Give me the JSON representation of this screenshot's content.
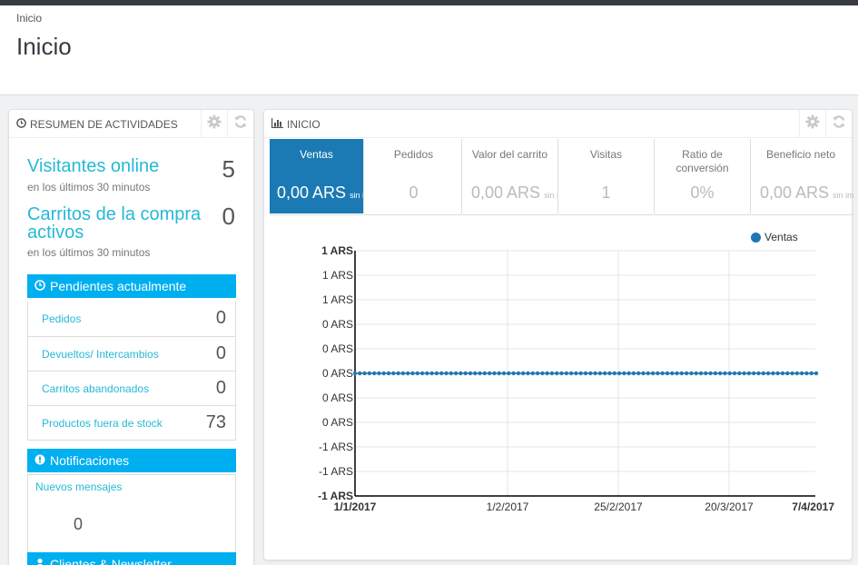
{
  "breadcrumb": "Inicio",
  "page_title": "Inicio",
  "activity": {
    "title": "Resumen de actividades",
    "visitors_label": "Visitantes online",
    "visitors_sub": "en los últimos 30 minutos",
    "visitors_value": "5",
    "carts_label": "Carritos de la compra activos",
    "carts_sub": "en los últimos 30 minutos",
    "carts_value": "0",
    "pending_title": "Pendientes actualmente",
    "pending": [
      {
        "label": "Pedidos",
        "count": "0"
      },
      {
        "label": "Devueltos/ Intercambios",
        "count": "0"
      },
      {
        "label": "Carritos abandonados",
        "count": "0"
      },
      {
        "label": "Productos fuera de stock",
        "count": "73"
      }
    ],
    "notif_title": "Notificaciones",
    "notif_label": "Nuevos mensajes",
    "notif_count": "0",
    "clients_title": "Clientes & Newsletter"
  },
  "inicio": {
    "title": "Inicio",
    "kpis": [
      {
        "title": "Ventas",
        "value": "0,00 ARS",
        "suffix": "sin i"
      },
      {
        "title": "Pedidos",
        "value": "0",
        "suffix": ""
      },
      {
        "title": "Valor del carrito",
        "value": "0,00 ARS",
        "suffix": "sin i"
      },
      {
        "title": "Visitas",
        "value": "1",
        "suffix": ""
      },
      {
        "title": "Ratio de conversión",
        "value": "0%",
        "suffix": ""
      },
      {
        "title": "Beneficio neto",
        "value": "0,00 ARS",
        "suffix": "sin imp"
      }
    ]
  },
  "colors": {
    "accent": "#25b9d7",
    "section": "#00aff0",
    "kpi_active": "#1b7ab3",
    "series": "#1f77b4"
  },
  "chart_data": {
    "type": "line",
    "series": [
      {
        "name": "Ventas",
        "values": [
          0
        ]
      }
    ],
    "x_ticks": [
      "1/1/2017",
      "1/2/2017",
      "25/2/2017",
      "20/3/2017",
      "7/4/2017"
    ],
    "y_ticks": [
      "-1 ARS",
      "-1 ARS",
      "-1 ARS",
      "0 ARS",
      "0 ARS",
      "0 ARS",
      "0 ARS",
      "0 ARS",
      "1 ARS",
      "1 ARS",
      "1 ARS"
    ],
    "x_range": [
      "1/1/2017",
      "7/4/2017"
    ],
    "y_value": 0,
    "grid": true,
    "legend": "top-right"
  }
}
